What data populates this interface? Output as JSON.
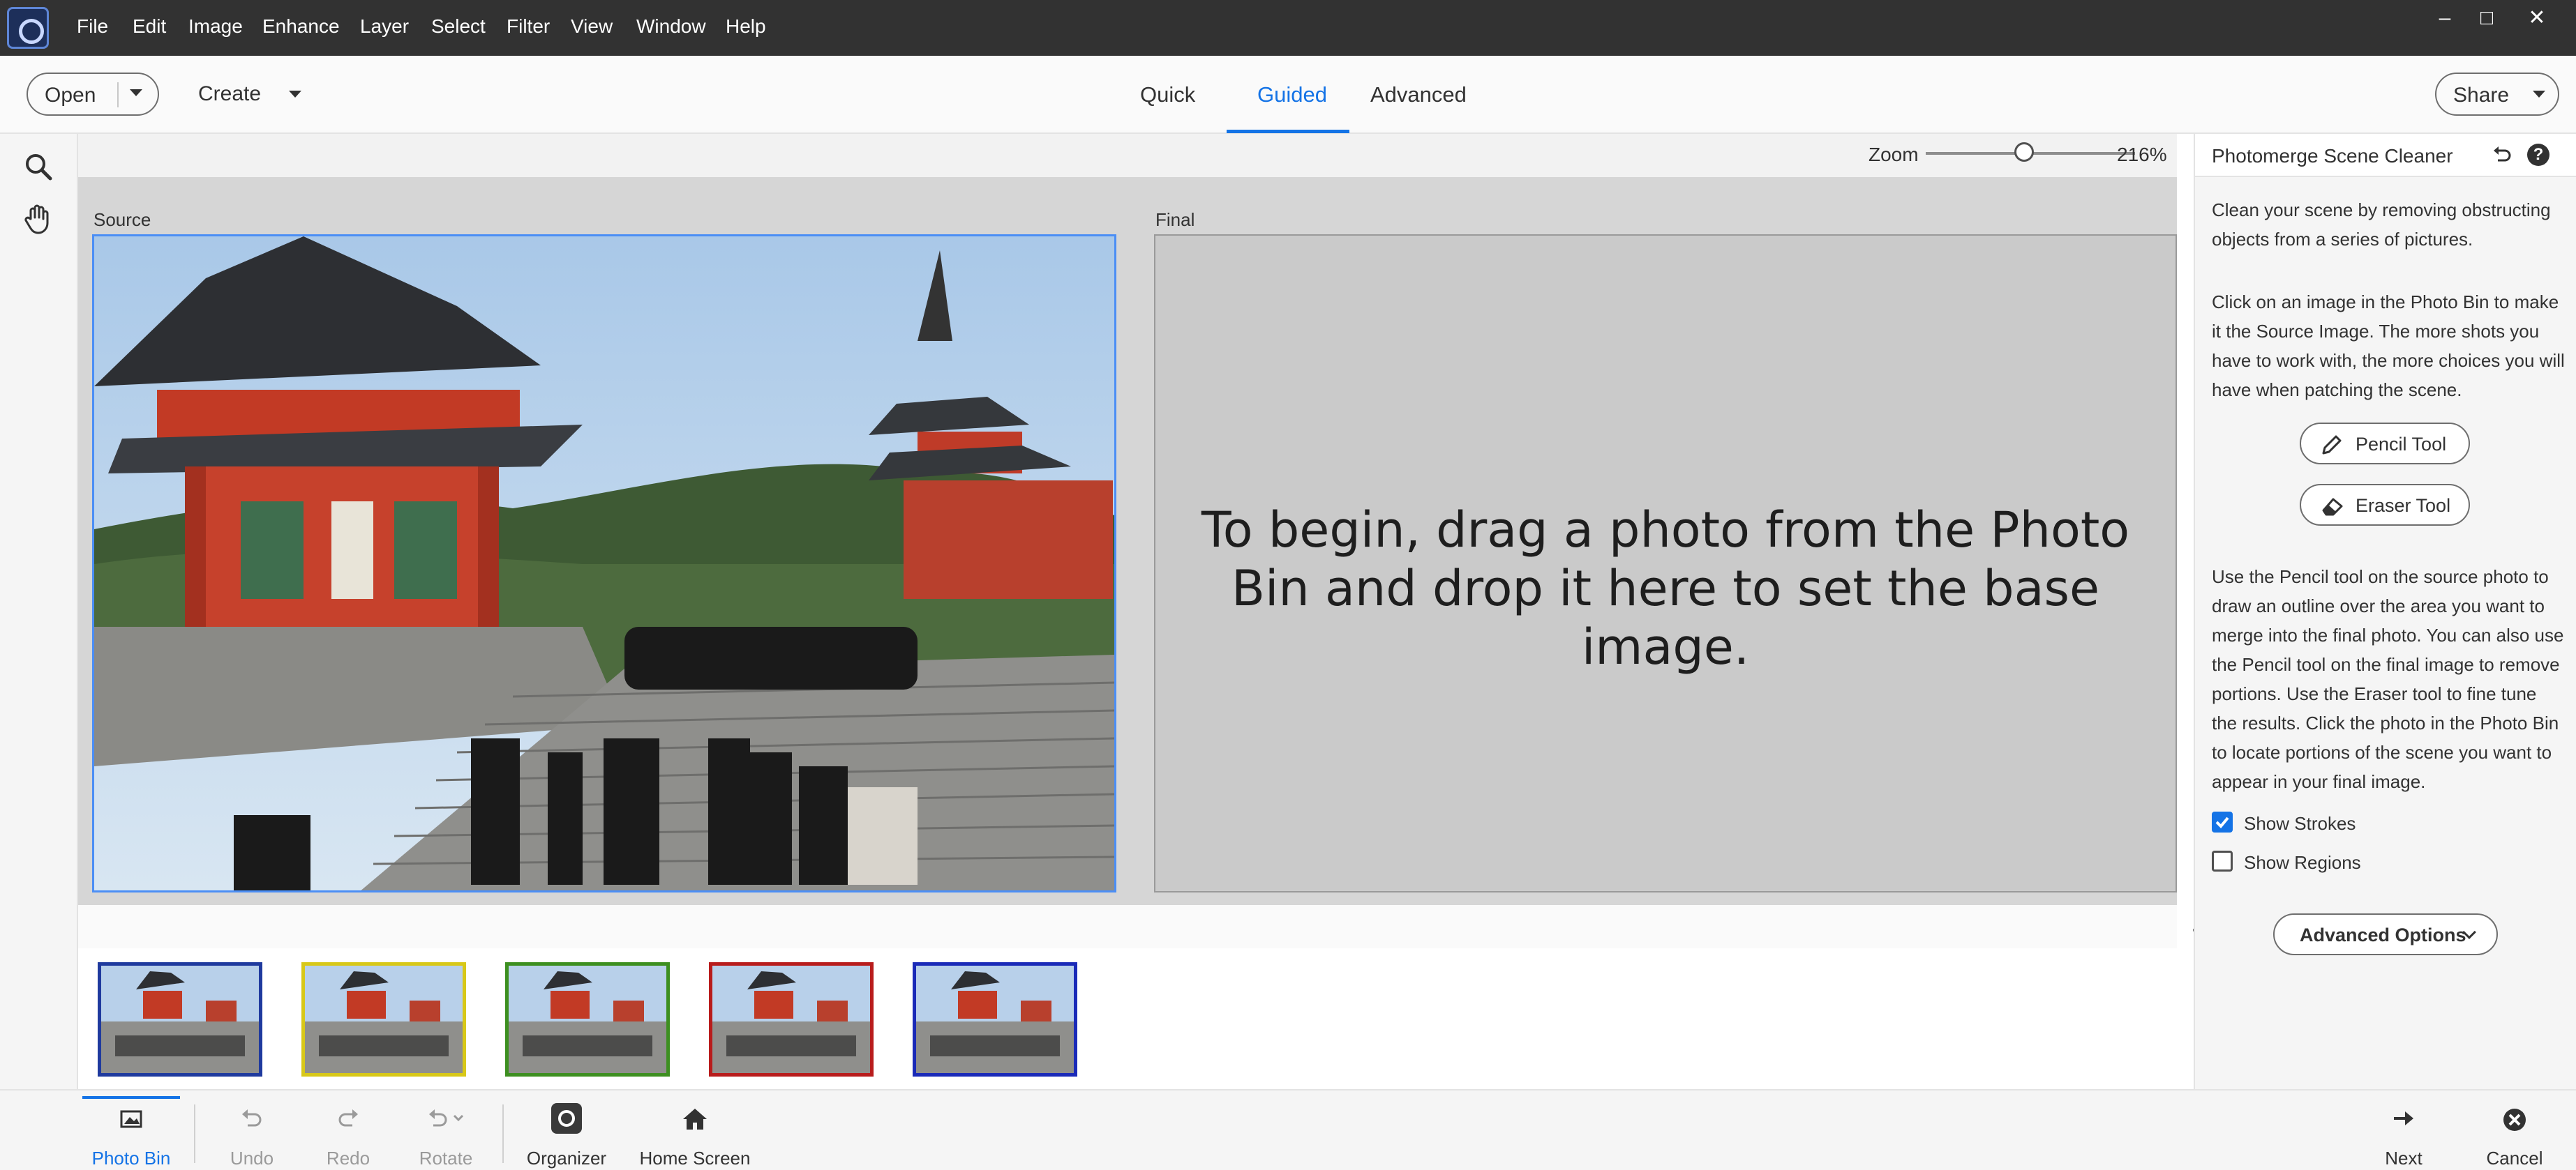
{
  "menu": [
    "File",
    "Edit",
    "Image",
    "Enhance",
    "Layer",
    "Select",
    "Filter",
    "View",
    "Window",
    "Help"
  ],
  "window_controls": {
    "minimize": "–",
    "maximize": "□",
    "close": "✕"
  },
  "modebar": {
    "open_label": "Open",
    "create_label": "Create",
    "tabs": [
      {
        "label": "Quick",
        "active": false
      },
      {
        "label": "Guided",
        "active": true
      },
      {
        "label": "Advanced",
        "active": false
      }
    ],
    "share_label": "Share"
  },
  "left_tools": [
    "zoom-tool",
    "hand-tool"
  ],
  "zoom": {
    "label": "Zoom",
    "value": "216%",
    "slider_fraction": 0.47
  },
  "canvas": {
    "source_label": "Source",
    "final_label": "Final",
    "final_hint": "To begin, drag a photo from the Photo Bin and drop it here to set the base image."
  },
  "photo_bin": {
    "more_icon": "ellipsis-icon",
    "thumbs": [
      {
        "border_color": "#1f3a9e"
      },
      {
        "border_color": "#d8c818"
      },
      {
        "border_color": "#3d8f20"
      },
      {
        "border_color": "#b81c1c"
      },
      {
        "border_color": "#1a2ab8"
      }
    ]
  },
  "panel": {
    "title": "Photomerge Scene Cleaner",
    "intro": "Clean your scene by removing obstructing objects from a series of pictures.",
    "instructions": "Click on an image in the Photo Bin to make it the Source Image. The more shots you have to work with, the more choices you will have when patching the scene.",
    "pencil_label": "Pencil Tool",
    "eraser_label": "Eraser Tool",
    "usage": "Use the Pencil tool on the source photo to draw an outline over the area you want to merge into the final photo. You can also use the Pencil tool on the final image to remove portions. Use the Eraser tool to fine tune the results. Click the photo in the Photo Bin to locate portions of the scene you want to appear in your final image.",
    "show_strokes_label": "Show Strokes",
    "show_strokes_checked": true,
    "show_regions_label": "Show Regions",
    "show_regions_checked": false,
    "advanced_label": "Advanced Options"
  },
  "bottombar": {
    "photo_bin": "Photo Bin",
    "undo": "Undo",
    "redo": "Redo",
    "rotate": "Rotate",
    "organizer": "Organizer",
    "home": "Home Screen",
    "next": "Next",
    "cancel": "Cancel"
  },
  "colors": {
    "accent": "#1473e6",
    "menubar": "#323232",
    "workspace": "#d6d6d6"
  }
}
